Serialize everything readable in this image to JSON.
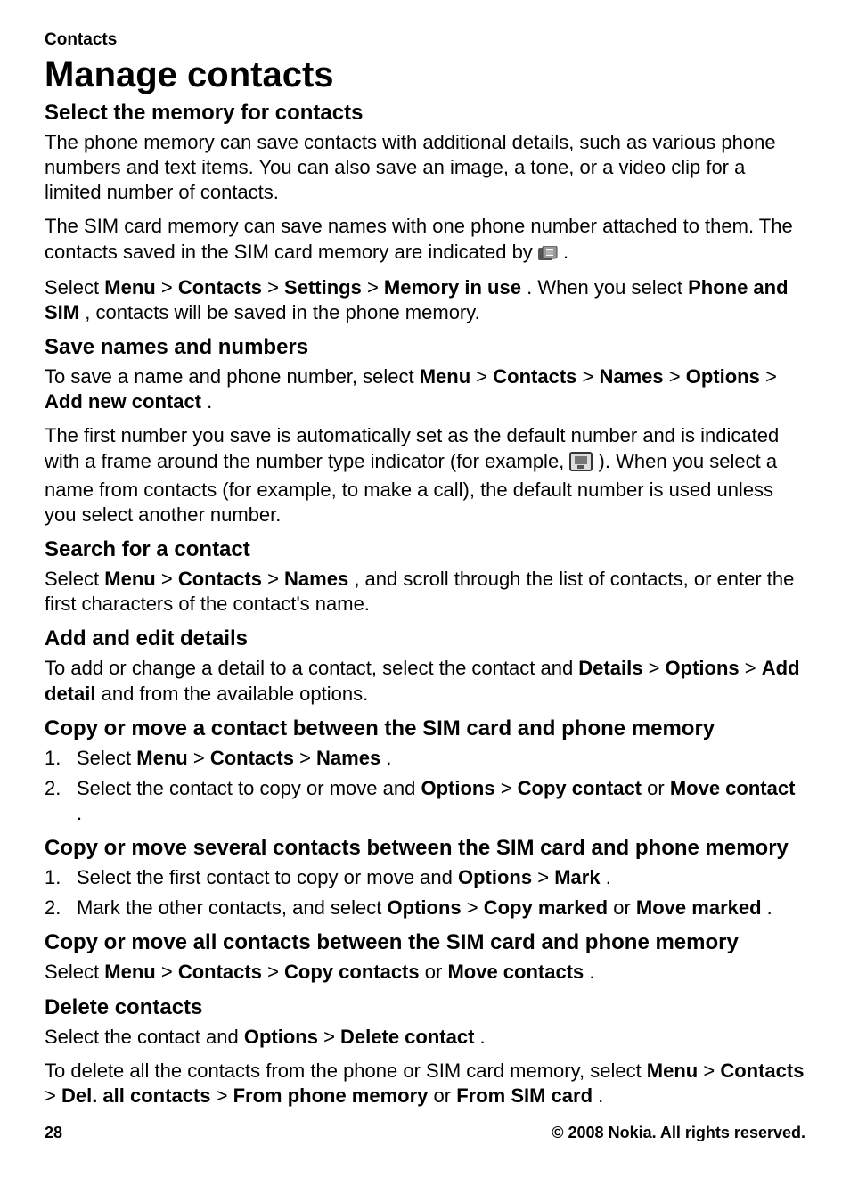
{
  "header": {
    "section": "Contacts"
  },
  "title": "Manage contacts",
  "s1": {
    "heading": "Select the memory for contacts",
    "p1": "The phone memory can save contacts with additional details, such as various phone numbers and text items. You can also save an image, a tone, or a video clip for a limited number of contacts.",
    "p2_a": "The SIM card memory can save names with one phone number attached to them. The contacts saved in the SIM card memory are indicated by ",
    "p2_b": " .",
    "p3": {
      "t1": "Select ",
      "menu": "Menu",
      "gt1": " > ",
      "contacts": "Contacts",
      "gt2": " > ",
      "settings": "Settings",
      "gt3": " > ",
      "mem": "Memory in use",
      "t2": ". When you select ",
      "phoneAndSim": "Phone and SIM",
      "t3": ", contacts will be saved in the phone memory."
    }
  },
  "s2": {
    "heading": "Save names and numbers",
    "p1": {
      "t1": "To save a name and phone number, select ",
      "menu": "Menu",
      "gt1": " > ",
      "contacts": "Contacts",
      "gt2": " > ",
      "names": "Names",
      "gt3": " > ",
      "options": "Options",
      "gt4": " > ",
      "add": "Add new contact",
      "t2": "."
    },
    "p2_a": "The first number you save is automatically set as the default number and is indicated with a frame around the number type indicator (for example, ",
    "p2_b": "). When you select a name from contacts (for example, to make a call), the default number is used unless you select another number."
  },
  "s3": {
    "heading": "Search for a contact",
    "p1": {
      "t1": "Select ",
      "menu": "Menu",
      "gt1": " > ",
      "contacts": "Contacts",
      "gt2": " > ",
      "names": "Names",
      "t2": ", and scroll through the list of contacts, or enter the first characters of the contact's name."
    }
  },
  "s4": {
    "heading": "Add and edit details",
    "p1": {
      "t1": "To add or change a detail to a contact, select the contact and ",
      "details": "Details",
      "gt1": " > ",
      "options": "Options",
      "gt2": " > ",
      "add": "Add detail",
      "t2": " and from the available options."
    }
  },
  "s5": {
    "heading": "Copy or move a contact between the SIM card and phone memory",
    "li1": {
      "num": "1.",
      "t1": "Select ",
      "menu": "Menu",
      "gt1": " > ",
      "contacts": "Contacts",
      "gt2": " > ",
      "names": "Names",
      "t2": "."
    },
    "li2": {
      "num": "2.",
      "t1": "Select the contact to copy or move and ",
      "options": "Options",
      "gt1": " > ",
      "copy": "Copy contact",
      "or": " or ",
      "move": "Move contact",
      "t2": "."
    }
  },
  "s6": {
    "heading": "Copy or move several contacts between the SIM card and phone memory",
    "li1": {
      "num": "1.",
      "t1": "Select the first contact to copy or move and ",
      "options": "Options",
      "gt1": " > ",
      "mark": "Mark",
      "t2": "."
    },
    "li2": {
      "num": "2.",
      "t1": "Mark the other contacts, and select ",
      "options": "Options",
      "gt1": " > ",
      "copy": "Copy marked",
      "or": " or ",
      "move": "Move marked",
      "t2": "."
    }
  },
  "s7": {
    "heading": "Copy or move all contacts between the SIM card and phone memory",
    "p1": {
      "t1": "Select ",
      "menu": "Menu",
      "gt1": " > ",
      "contacts": "Contacts",
      "gt2": " > ",
      "copy": "Copy contacts",
      "or": " or ",
      "move": "Move contacts",
      "t2": "."
    }
  },
  "s8": {
    "heading": "Delete contacts",
    "p1": {
      "t1": "Select the contact and ",
      "options": "Options",
      "gt1": " > ",
      "del": "Delete contact",
      "t2": "."
    },
    "p2": {
      "t1": "To delete all the contacts from the phone or SIM card memory, select ",
      "menu": "Menu",
      "gt1": " > ",
      "contacts": "Contacts",
      "gt2": " > ",
      "delall": "Del. all contacts",
      "gt3": " > ",
      "fromPhone": "From phone memory",
      "or": " or ",
      "fromSim": "From SIM card",
      "t2": "."
    }
  },
  "footer": {
    "page": "28",
    "copyright": "© 2008 Nokia. All rights reserved."
  }
}
